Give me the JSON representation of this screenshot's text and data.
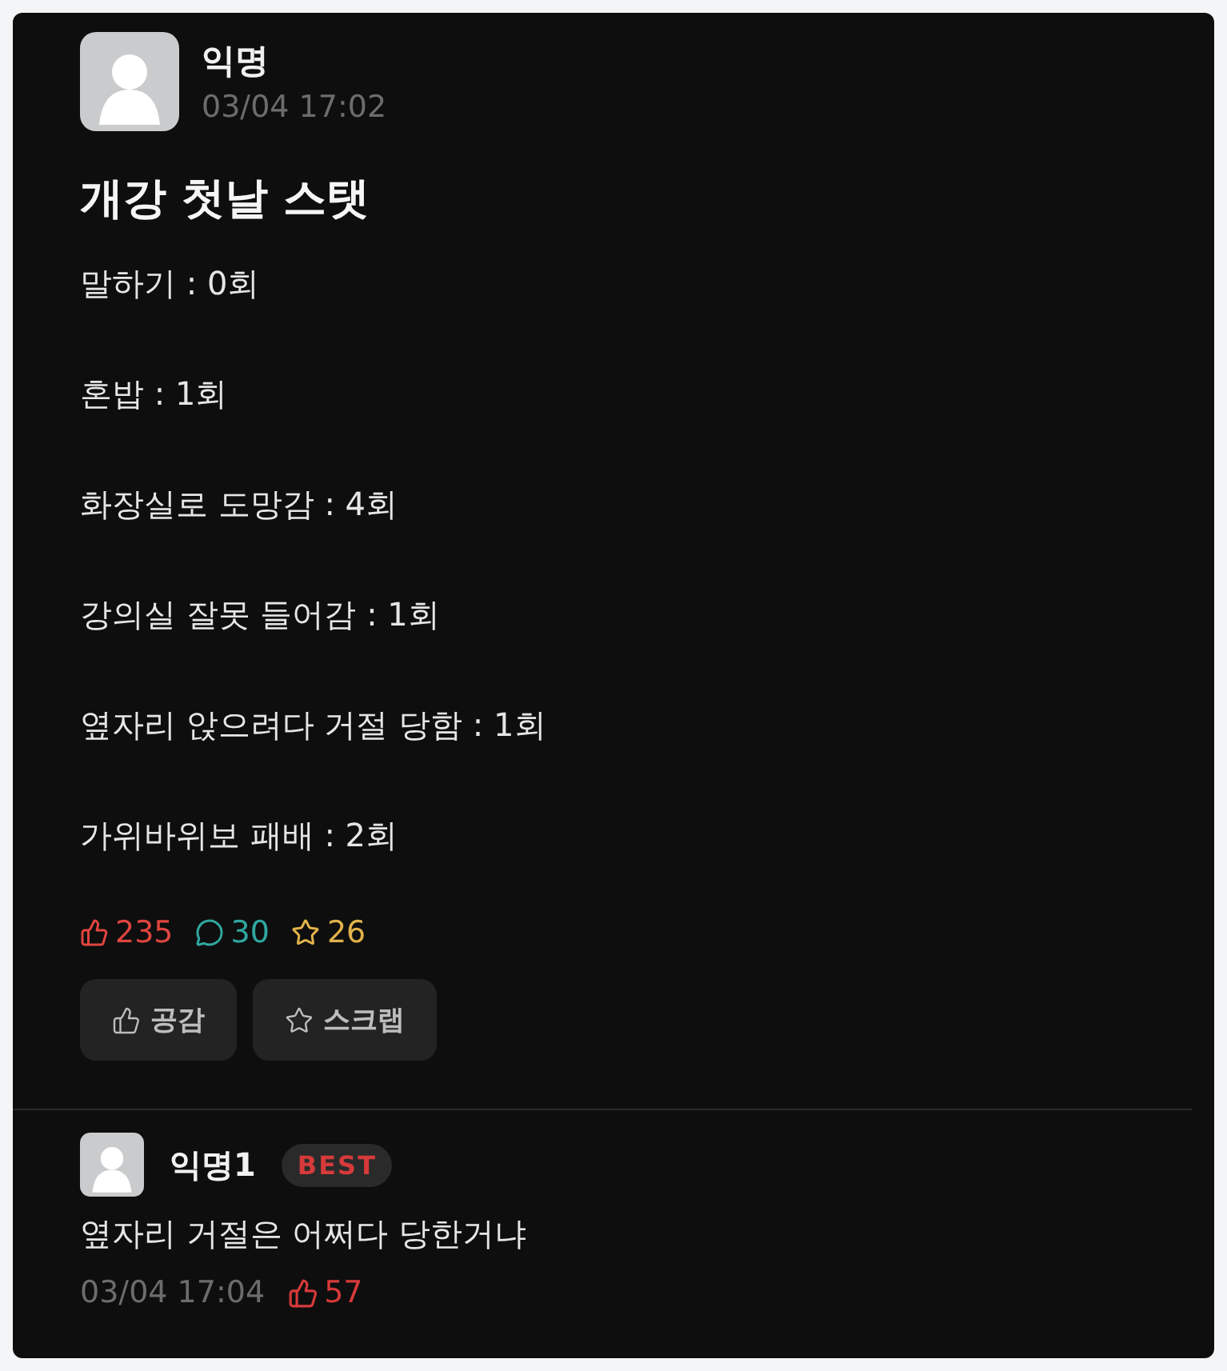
{
  "post": {
    "author": "익명",
    "time": "03/04 17:02",
    "title": "개강 첫날 스탯",
    "lines": [
      "말하기 : 0회",
      "혼밥 : 1회",
      "화장실로 도망감 : 4회",
      "강의실 잘못 들어감 : 1회",
      "옆자리 앉으려다 거절 당함 : 1회",
      "가위바위보 패배 : 2회"
    ],
    "stats": [
      {
        "kind": "like",
        "count": "235",
        "color": "#e0453f"
      },
      {
        "kind": "comment",
        "count": "30",
        "color": "#2fa7a0"
      },
      {
        "kind": "scrap",
        "count": "26",
        "color": "#e0b24a"
      }
    ],
    "buttons": [
      {
        "kind": "like",
        "label": "공감"
      },
      {
        "kind": "scrap",
        "label": "스크랩"
      }
    ]
  },
  "comments": [
    {
      "author": "익명1",
      "badge": "BEST",
      "text": "옆자리 거절은 어쩌다 당한거냐",
      "time": "03/04 17:04",
      "likes": "57"
    }
  ]
}
